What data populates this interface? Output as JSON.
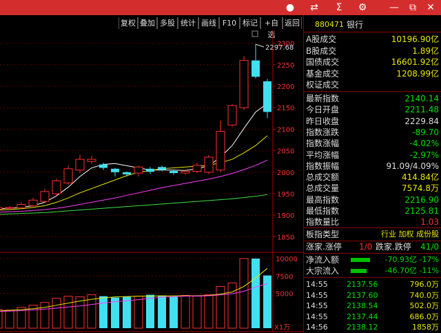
{
  "toolbar": {
    "buttons": [
      "复权",
      "叠加",
      "多股",
      "统计",
      "画线",
      "F10",
      "标记",
      "+自选",
      "返回"
    ]
  },
  "stock": {
    "code": "880471",
    "name": "银行"
  },
  "quote": [
    {
      "label": "A股成交",
      "value": "10196.90亿",
      "color": "#e8e800"
    },
    {
      "label": "B股成交",
      "value": "1.89亿",
      "color": "#e8e800"
    },
    {
      "label": "国债成交",
      "value": "16601.92亿",
      "color": "#e8e800"
    },
    {
      "label": "基金成交",
      "value": "1208.99亿",
      "color": "#e8e800"
    },
    {
      "label": "权证成交",
      "value": "",
      "color": "#e8e800"
    }
  ],
  "index_info": [
    {
      "label": "最新指数",
      "value": "2140.14",
      "color": "#00e000"
    },
    {
      "label": "今日开盘",
      "value": "2211.48",
      "color": "#00e000"
    },
    {
      "label": "昨日收盘",
      "value": "2229.84",
      "color": "#dddddd"
    },
    {
      "label": "指数涨跌",
      "value": "-89.70",
      "color": "#00e000"
    },
    {
      "label": "指数涨幅",
      "value": "-4.02%",
      "color": "#00e000"
    },
    {
      "label": "平均涨幅",
      "value": "-2.97%",
      "color": "#00e000"
    },
    {
      "label": "指数振幅",
      "value": "91.09/4.09%",
      "color": "#dddddd"
    },
    {
      "label": "总成交额",
      "value": "414.84亿",
      "color": "#e8e800"
    },
    {
      "label": "总成交量",
      "value": "7574.8万",
      "color": "#e8e800"
    },
    {
      "label": "最高指数",
      "value": "2216.90",
      "color": "#00e000"
    },
    {
      "label": "最低指数",
      "value": "2125.81",
      "color": "#00e000"
    },
    {
      "label": "指数量比",
      "value": "1.03",
      "color": "#ff3030"
    }
  ],
  "type_row": {
    "label": "板指类型",
    "value": "行业 加权 成份股",
    "color": "#e8e800"
  },
  "limit_row": {
    "label1": "涨家.涨停",
    "value1": "1/0",
    "label2": "跌家.跌停",
    "value2": "41/0"
  },
  "flow": [
    {
      "label": "净流入额",
      "value": "-70.93亿",
      "pct": "-17%",
      "bar": 0.55
    },
    {
      "label": "大宗流入",
      "value": "-46.70亿",
      "pct": "-11%",
      "bar": 0.45
    }
  ],
  "ticks": [
    {
      "time": "14:55",
      "price": "2137.56",
      "vol": "796.0万"
    },
    {
      "time": "14:55",
      "price": "2137.60",
      "vol": "740.0万"
    },
    {
      "time": "14:55",
      "price": "2138.54",
      "vol": "502.0万"
    },
    {
      "time": "14:55",
      "price": "2137.44",
      "vol": "686.0万"
    },
    {
      "time": "14:56",
      "price": "2138.12",
      "vol": "1858万"
    }
  ],
  "chart_data": {
    "type": "candlestick",
    "price_axis": {
      "ticks": [
        1850,
        1900,
        1950,
        2000,
        2050,
        2100,
        2150,
        2200,
        2250,
        2300
      ],
      "range": [
        1820,
        2330
      ]
    },
    "volume_axis": {
      "ticks": [
        5000,
        7500,
        10000
      ],
      "range": [
        0,
        10500
      ],
      "unit_label": "X1万"
    },
    "high_annotation": "2297.68",
    "candles": [
      {
        "o": 1908,
        "c": 1915,
        "h": 1920,
        "l": 1905
      },
      {
        "o": 1912,
        "c": 1916,
        "h": 1921,
        "l": 1909
      },
      {
        "o": 1914,
        "c": 1918,
        "h": 1924,
        "l": 1910
      },
      {
        "o": 1916,
        "c": 1918,
        "h": 1921,
        "l": 1913
      },
      {
        "o": 1917,
        "c": 1925,
        "h": 1930,
        "l": 1914
      },
      {
        "o": 1922,
        "c": 1935,
        "h": 1940,
        "l": 1918
      },
      {
        "o": 1932,
        "c": 1955,
        "h": 1962,
        "l": 1928
      },
      {
        "o": 1950,
        "c": 1980,
        "h": 1985,
        "l": 1945
      },
      {
        "o": 1975,
        "c": 2008,
        "h": 2015,
        "l": 1970
      },
      {
        "o": 2005,
        "c": 2030,
        "h": 2040,
        "l": 1998
      },
      {
        "o": 2025,
        "c": 2030,
        "h": 2038,
        "l": 2020
      },
      {
        "o": 2018,
        "c": 2010,
        "h": 2022,
        "l": 2005
      },
      {
        "o": 2008,
        "c": 2000,
        "h": 2010,
        "l": 1990
      },
      {
        "o": 2000,
        "c": 1995,
        "h": 2002,
        "l": 1990
      },
      {
        "o": 1998,
        "c": 2012,
        "h": 2015,
        "l": 1990
      },
      {
        "o": 2008,
        "c": 2001,
        "h": 2012,
        "l": 1996
      },
      {
        "o": 2012,
        "c": 2006,
        "h": 2015,
        "l": 2002
      },
      {
        "o": 2003,
        "c": 1998,
        "h": 2006,
        "l": 1994
      },
      {
        "o": 1998,
        "c": 2002,
        "h": 2006,
        "l": 1994
      },
      {
        "o": 2002,
        "c": 2016,
        "h": 2022,
        "l": 1998
      },
      {
        "o": 2000,
        "c": 2035,
        "h": 2040,
        "l": 1995
      },
      {
        "o": 2005,
        "c": 2095,
        "h": 2120,
        "l": 2000
      },
      {
        "o": 2110,
        "c": 2155,
        "h": 2158,
        "l": 2105
      },
      {
        "o": 2150,
        "c": 2260,
        "h": 2270,
        "l": 2145
      },
      {
        "o": 2260,
        "c": 2222,
        "h": 2297.68,
        "l": 2218
      },
      {
        "o": 2211.48,
        "c": 2140.14,
        "h": 2216.9,
        "l": 2125.81
      }
    ],
    "ma": [
      {
        "name": "MA5",
        "color": "#ffffff",
        "values": [
          1911,
          1913,
          1915,
          1916,
          1918,
          1922,
          1930,
          1945,
          1965,
          1990,
          2010,
          2018,
          2020,
          2015,
          2010,
          2005,
          2005,
          2005,
          2004,
          2008,
          2015,
          2035,
          2062,
          2102,
          2140,
          2160
        ]
      },
      {
        "name": "MA10",
        "color": "#e8e800",
        "values": [
          1909,
          1910,
          1912,
          1913,
          1915,
          1918,
          1922,
          1930,
          1940,
          1952,
          1962,
          1972,
          1982,
          1992,
          2000,
          2004,
          2008,
          2010,
          2012,
          2014,
          2016,
          2022,
          2030,
          2045,
          2062,
          2085
        ]
      },
      {
        "name": "MA20",
        "color": "#ff40ff",
        "values": [
          1905,
          1906,
          1907,
          1908,
          1909,
          1911,
          1913,
          1916,
          1920,
          1925,
          1930,
          1935,
          1940,
          1946,
          1952,
          1958,
          1964,
          1969,
          1974,
          1979,
          1984,
          1990,
          1997,
          2006,
          2016,
          2028
        ]
      },
      {
        "name": "MA60",
        "color": "#40e040",
        "values": [
          1900,
          1901,
          1902,
          1903,
          1904,
          1905,
          1906,
          1908,
          1910,
          1912,
          1914,
          1916,
          1918,
          1920,
          1922,
          1924,
          1926,
          1928,
          1930,
          1932,
          1934,
          1936,
          1938,
          1941,
          1944,
          1948
        ]
      }
    ],
    "volumes": [
      2300,
      2400,
      2700,
      2600,
      3000,
      3300,
      3700,
      4300,
      4600,
      4500,
      4800,
      4600,
      4400,
      4500,
      4600,
      4800,
      4700,
      4500,
      4700,
      4600,
      4800,
      6000,
      6500,
      10000,
      10000,
      7574.8
    ],
    "vol_ma": [
      {
        "name": "VMA5",
        "color": "#e8e800",
        "values": [
          2350,
          2400,
          2480,
          2560,
          2660,
          2800,
          3000,
          3300,
          3600,
          3900,
          4150,
          4350,
          4500,
          4550,
          4600,
          4620,
          4640,
          4640,
          4650,
          4660,
          4700,
          4900,
          5200,
          6000,
          7200,
          8600
        ]
      },
      {
        "name": "VMA10",
        "color": "#ff40ff",
        "values": [
          2300,
          2340,
          2400,
          2450,
          2520,
          2620,
          2740,
          2880,
          3050,
          3200,
          3400,
          3600,
          3800,
          3950,
          4100,
          4300,
          4450,
          4550,
          4600,
          4620,
          4650,
          4780,
          4950,
          5300,
          5900,
          6400
        ]
      }
    ]
  }
}
